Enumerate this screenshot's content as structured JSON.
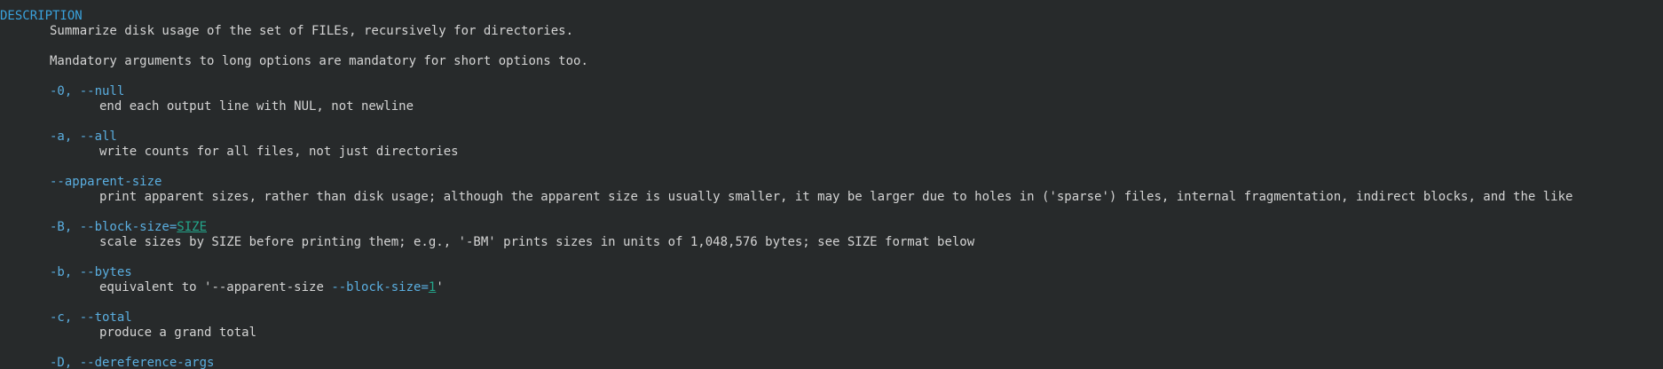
{
  "section_title": "DESCRIPTION",
  "intro": [
    "Summarize disk usage of the set of FILEs, recursively for directories.",
    "Mandatory arguments to long options are mandatory for short options too."
  ],
  "options": [
    {
      "flag": "-0, --null",
      "desc": "end each output line with NUL, not newline"
    },
    {
      "flag": "-a, --all",
      "desc": "write counts for all files, not just directories"
    },
    {
      "flag": "--apparent-size",
      "desc": "print apparent sizes, rather than disk usage; although the apparent size is usually smaller, it may be larger due to holes in ('sparse') files, internal fragmentation, indirect blocks, and the like"
    },
    {
      "flag": "-B, --block-size=",
      "flag_arg": "SIZE",
      "desc": "scale sizes by SIZE before printing them; e.g., '-BM' prints sizes in units of 1,048,576 bytes; see SIZE format below"
    },
    {
      "flag": "-b, --bytes",
      "desc_prefix": "equivalent to '",
      "desc_opt1": "--apparent-size",
      "desc_sep": " ",
      "desc_opt2": "--block-size=",
      "desc_arg": "1",
      "desc_suffix": "'"
    },
    {
      "flag": "-c, --total",
      "desc": "produce a grand total"
    },
    {
      "flag": "-D, --dereference-args"
    }
  ]
}
